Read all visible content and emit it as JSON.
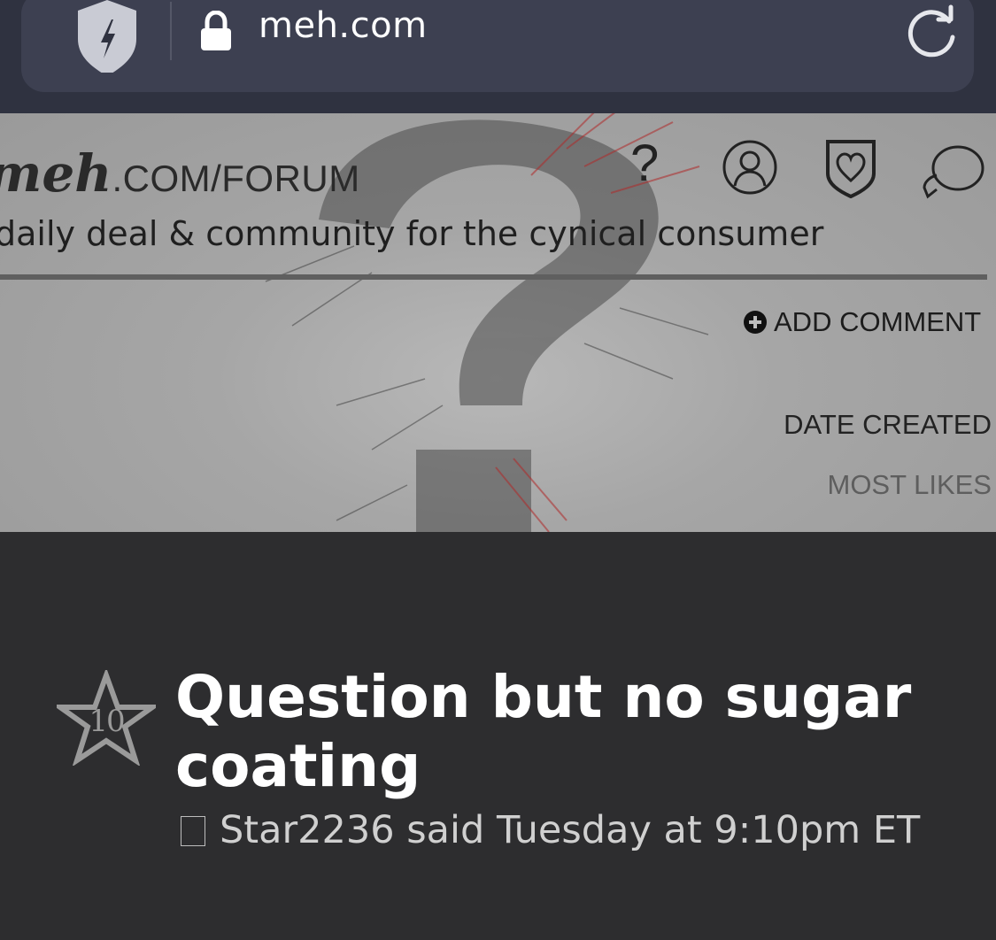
{
  "browser": {
    "url": "meh.com",
    "icons": [
      "shield-bolt-icon",
      "lock-icon",
      "reload-icon"
    ]
  },
  "site": {
    "logo_main": "meh",
    "logo_rest": ".COM/FORUM",
    "tagline": "daily deal & community for the cynical consumer",
    "nav_icons": [
      "help-icon",
      "account-icon",
      "heart-shield-icon",
      "chat-bubbles-icon"
    ],
    "help_glyph": "?"
  },
  "toolbar": {
    "add_comment_label": "ADD COMMENT"
  },
  "sort": {
    "options": [
      "DATE CREATED",
      "MOST LIKES"
    ],
    "selected": "DATE CREATED"
  },
  "post": {
    "star_count": "10",
    "title": "Question but no sugar coating",
    "author": "Star2236",
    "meta_text": "Star2236 said Tuesday at 9:10pm ET"
  },
  "colors": {
    "browser_bar": "#2f3240",
    "url_pill": "#3d4051",
    "content_bg": "#2d2d2f",
    "title_text": "#ffffff"
  }
}
